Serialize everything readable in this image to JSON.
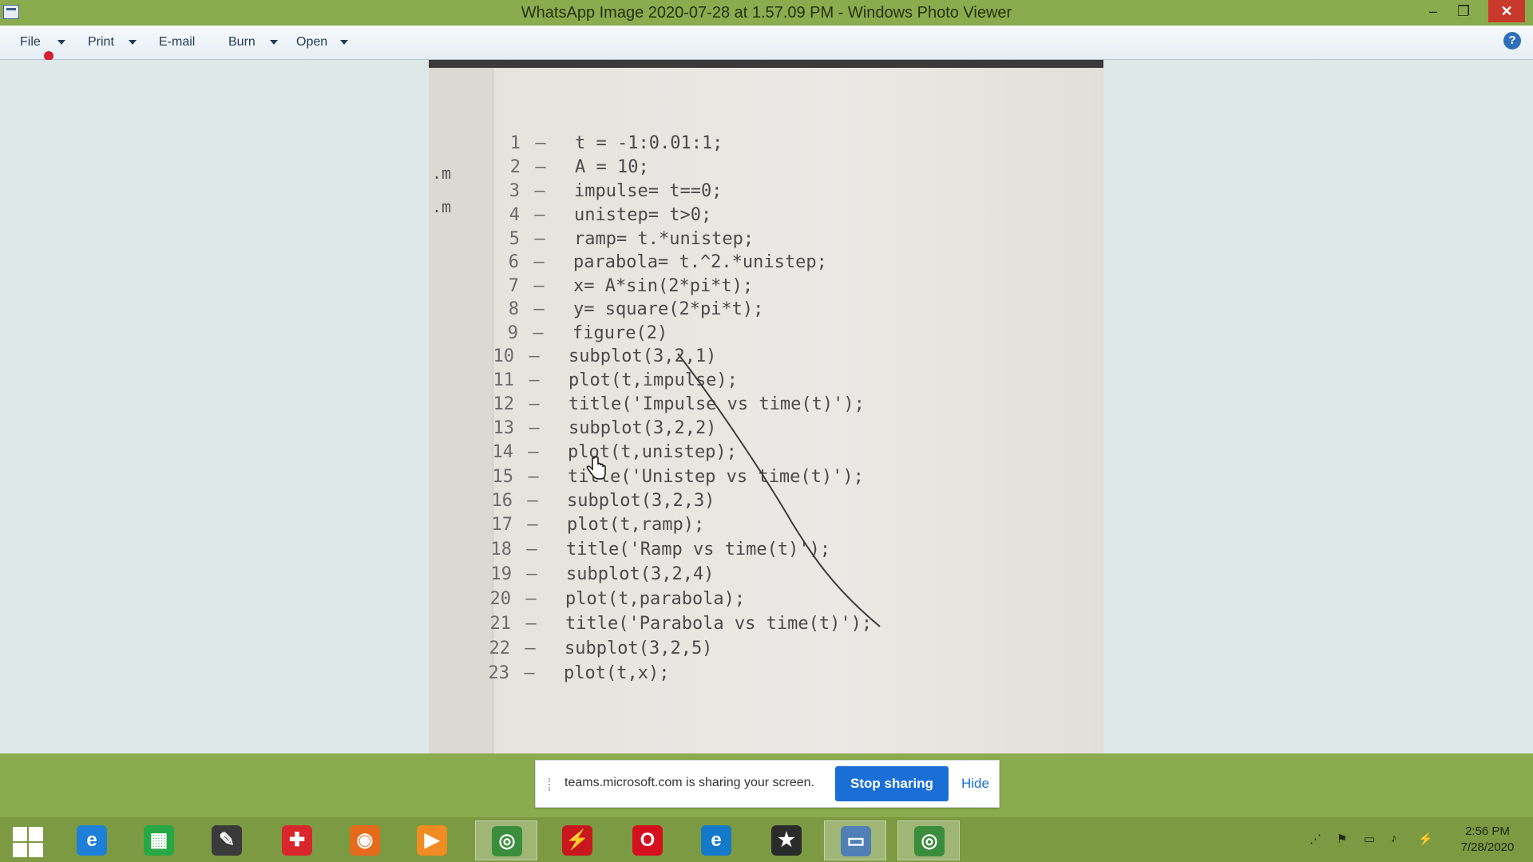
{
  "window": {
    "title": "WhatsApp Image 2020-07-28 at 1.57.09 PM - Windows Photo Viewer",
    "min_glyph": "–",
    "max_glyph": "❐",
    "close_glyph": "✕"
  },
  "menu": {
    "file": "File",
    "print": "Print",
    "email": "E-mail",
    "burn": "Burn",
    "open": "Open",
    "help_glyph": "?"
  },
  "photo": {
    "file_items": [
      ".m",
      ".m"
    ],
    "code_lines": [
      {
        "n": "1",
        "dash": "–",
        "code": "t = -1:0.01:1;"
      },
      {
        "n": "2",
        "dash": "–",
        "code": "A = 10;"
      },
      {
        "n": "3",
        "dash": "–",
        "code": "impulse= t==0;"
      },
      {
        "n": "4",
        "dash": "–",
        "code": "unistep= t>0;"
      },
      {
        "n": "5",
        "dash": "–",
        "code": "ramp= t.*unistep;"
      },
      {
        "n": "6",
        "dash": "–",
        "code": "parabola= t.^2.*unistep;"
      },
      {
        "n": "7",
        "dash": "–",
        "code": "x= A*sin(2*pi*t);"
      },
      {
        "n": "8",
        "dash": "–",
        "code": "y= square(2*pi*t);"
      },
      {
        "n": "9",
        "dash": "–",
        "code": "figure(2)"
      },
      {
        "n": "10",
        "dash": "–",
        "code": "subplot(3,2,1)"
      },
      {
        "n": "11",
        "dash": "–",
        "code": "plot(t,impulse);"
      },
      {
        "n": "12",
        "dash": "–",
        "code": "title('Impulse vs time(t)');"
      },
      {
        "n": "13",
        "dash": "–",
        "code": "subplot(3,2,2)"
      },
      {
        "n": "14",
        "dash": "–",
        "code": "plot(t,unistep);"
      },
      {
        "n": "15",
        "dash": "–",
        "code": "title('Unistep vs time(t)');"
      },
      {
        "n": "16",
        "dash": "–",
        "code": "subplot(3,2,3)"
      },
      {
        "n": "17",
        "dash": "–",
        "code": "plot(t,ramp);"
      },
      {
        "n": "18",
        "dash": "–",
        "code": "title('Ramp vs time(t)');"
      },
      {
        "n": "19",
        "dash": "–",
        "code": "subplot(3,2,4)"
      },
      {
        "n": "20",
        "dash": "–",
        "code": "plot(t,parabola);"
      },
      {
        "n": "21",
        "dash": "–",
        "code": "title('Parabola vs time(t)');"
      },
      {
        "n": "22",
        "dash": "–",
        "code": "subplot(3,2,5)"
      },
      {
        "n": "23",
        "dash": "–",
        "code": "plot(t,x);"
      }
    ]
  },
  "sharing": {
    "message": "teams.microsoft.com is sharing your screen.",
    "stop": "Stop sharing",
    "hide": "Hide"
  },
  "taskbar": {
    "apps": [
      {
        "name": "ie-icon",
        "color": "#1e7fd8",
        "glyph": "e"
      },
      {
        "name": "store-icon",
        "color": "#27a844",
        "glyph": "▦"
      },
      {
        "name": "app-icon",
        "color": "#3a3a3a",
        "glyph": "✎"
      },
      {
        "name": "security-icon",
        "color": "#d8262c",
        "glyph": "✚"
      },
      {
        "name": "firefox-icon",
        "color": "#e66a1c",
        "glyph": "◉"
      },
      {
        "name": "media-player-icon",
        "color": "#f08c22",
        "glyph": "▶"
      },
      {
        "name": "chrome-icon",
        "color": "#3b8d3e",
        "glyph": "◎"
      },
      {
        "name": "acrobat-icon",
        "color": "#c8171e",
        "glyph": "⚡"
      },
      {
        "name": "opera-icon",
        "color": "#d40f1e",
        "glyph": "O"
      },
      {
        "name": "edge-icon",
        "color": "#1479c9",
        "glyph": "e"
      },
      {
        "name": "movie-maker-icon",
        "color": "#2b2b2b",
        "glyph": "★"
      },
      {
        "name": "photo-viewer-icon",
        "color": "#4f7fb5",
        "glyph": "▭"
      },
      {
        "name": "chrome-icon-2",
        "color": "#3b8d3e",
        "glyph": "◎"
      }
    ],
    "clock_time": "2:56 PM",
    "clock_date": "7/28/2020"
  },
  "colors": {
    "titlebar": "#8bac4e",
    "taskbar": "#7b9a42",
    "accent": "#1a6fd6"
  }
}
